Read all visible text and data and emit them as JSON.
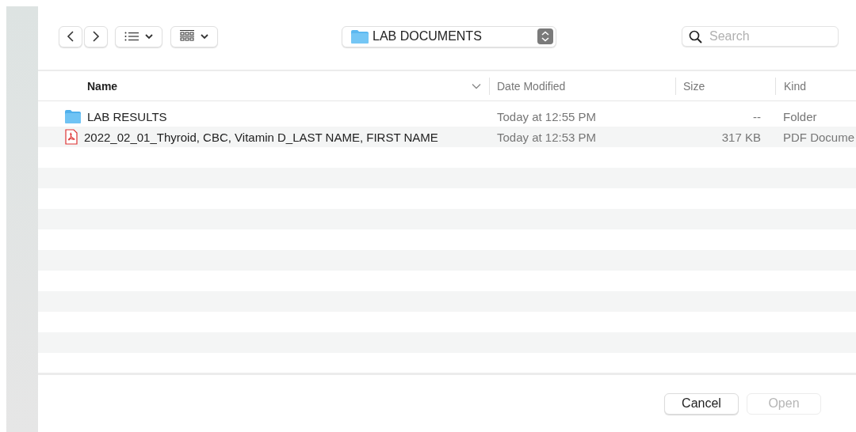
{
  "toolbar": {
    "location": "LAB DOCUMENTS",
    "search": {
      "placeholder": "Search"
    }
  },
  "table": {
    "columns": [
      {
        "label": "Name",
        "sorted": true
      },
      {
        "label": "Date Modified",
        "sorted": false
      },
      {
        "label": "Size",
        "sorted": false
      },
      {
        "label": "Kind",
        "sorted": false
      }
    ],
    "rows": [
      {
        "kind": "folder",
        "name": "LAB RESULTS",
        "date": "Today at 12:55 PM",
        "size": "--",
        "type": "Folder"
      },
      {
        "kind": "pdf",
        "name": "2022_02_01_Thyroid, CBC, Vitamin D_LAST NAME, FIRST NAME",
        "date": "Today at 12:53 PM",
        "size": "317 KB",
        "type": "PDF Docume"
      }
    ]
  },
  "buttons": [
    {
      "label": "Cancel",
      "disabled": false
    },
    {
      "label": "Open",
      "disabled": true
    }
  ]
}
